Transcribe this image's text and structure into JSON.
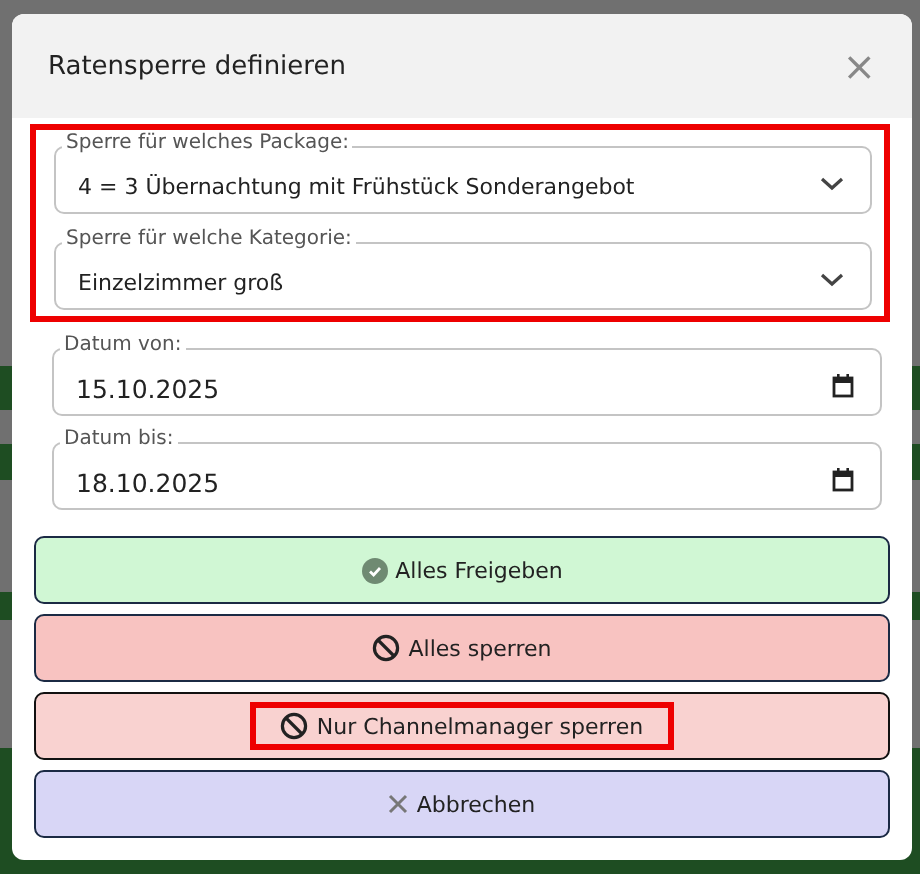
{
  "dialog": {
    "title": "Ratensperre definieren",
    "close": "×"
  },
  "selects_highlighted": true,
  "selects": [
    {
      "label": "Sperre für welches Package:",
      "value": "4 = 3 Übernachtung mit Frühstück Sonderangebot"
    },
    {
      "label": "Sperre für welche Kategorie:",
      "value": "Einzelzimmer groß"
    }
  ],
  "dates": [
    {
      "label": "Datum von:",
      "value": "15.10.2025"
    },
    {
      "label": "Datum bis:",
      "value": "18.10.2025"
    }
  ],
  "buttons": [
    {
      "label": "Alles Freigeben",
      "kind": "release",
      "highlighted": false
    },
    {
      "label": "Alles sperren",
      "kind": "block",
      "highlighted": false
    },
    {
      "label": "Nur Channelmanager sperren",
      "kind": "block-light",
      "highlighted": true
    },
    {
      "label": "Abbrechen",
      "kind": "cancel",
      "highlighted": false
    }
  ]
}
